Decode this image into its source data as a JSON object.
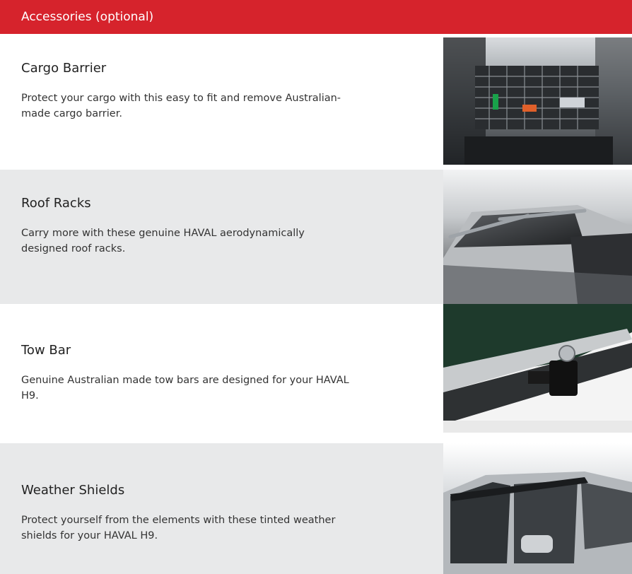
{
  "header": {
    "title": "Accessories (optional)"
  },
  "accessories": [
    {
      "title": "Cargo Barrier",
      "description": "Protect your cargo with this easy to fit and remove Australian-made cargo barrier.",
      "image_name": "cargo-barrier-photo"
    },
    {
      "title": "Roof Racks",
      "description": "Carry more with these genuine HAVAL aerodynamically designed roof racks.",
      "image_name": "roof-racks-photo"
    },
    {
      "title": "Tow Bar",
      "description": "Genuine Australian made tow bars are designed for your HAVAL H9.",
      "image_name": "tow-bar-photo"
    },
    {
      "title": "Weather Shields",
      "description": "Protect yourself from the elements with these tinted weather shields for your HAVAL H9.",
      "image_name": "weather-shields-photo"
    }
  ],
  "colors": {
    "header_bg": "#d6232c",
    "alt_row_bg": "#e8e9ea"
  }
}
